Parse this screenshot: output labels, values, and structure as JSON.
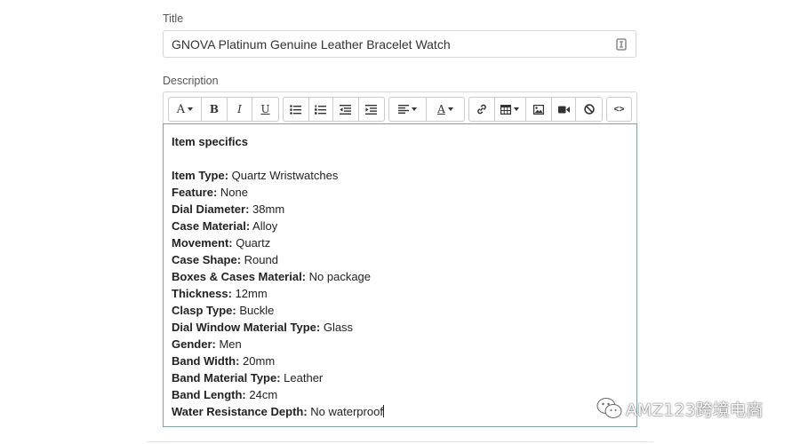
{
  "form": {
    "title_label": "Title",
    "title_value": "GNOVA Platinum Genuine Leather Bracelet Watch",
    "description_label": "Description"
  },
  "toolbar": {
    "font_style": "A",
    "bold": "B",
    "italic": "I",
    "underline": "U",
    "font_color": "A",
    "code_view": "<>"
  },
  "content": {
    "heading": "Item specifics",
    "specs": [
      {
        "key": "Item Type:",
        "value": " Quartz Wristwatches"
      },
      {
        "key": "Feature:",
        "value": " None"
      },
      {
        "key": "Dial Diameter:",
        "value": " 38mm"
      },
      {
        "key": "Case Material:",
        "value": " Alloy"
      },
      {
        "key": "Movement:",
        "value": " Quartz"
      },
      {
        "key": "Case Shape:",
        "value": " Round"
      },
      {
        "key": "Boxes & Cases Material:",
        "value": " No package"
      },
      {
        "key": "Thickness:",
        "value": " 12mm"
      },
      {
        "key": "Clasp Type:",
        "value": " Buckle"
      },
      {
        "key": "Dial Window Material Type:",
        "value": " Glass"
      },
      {
        "key": "Gender:",
        "value": " Men"
      },
      {
        "key": "Band Width:",
        "value": " 20mm"
      },
      {
        "key": "Band Material Type:",
        "value": " Leather"
      },
      {
        "key": "Band Length:",
        "value": " 24cm"
      },
      {
        "key": "Water Resistance Depth:",
        "value": " No waterproof"
      }
    ]
  },
  "watermark": {
    "text": "AMZ123跨境电商",
    "icon": "wechat-icon"
  }
}
